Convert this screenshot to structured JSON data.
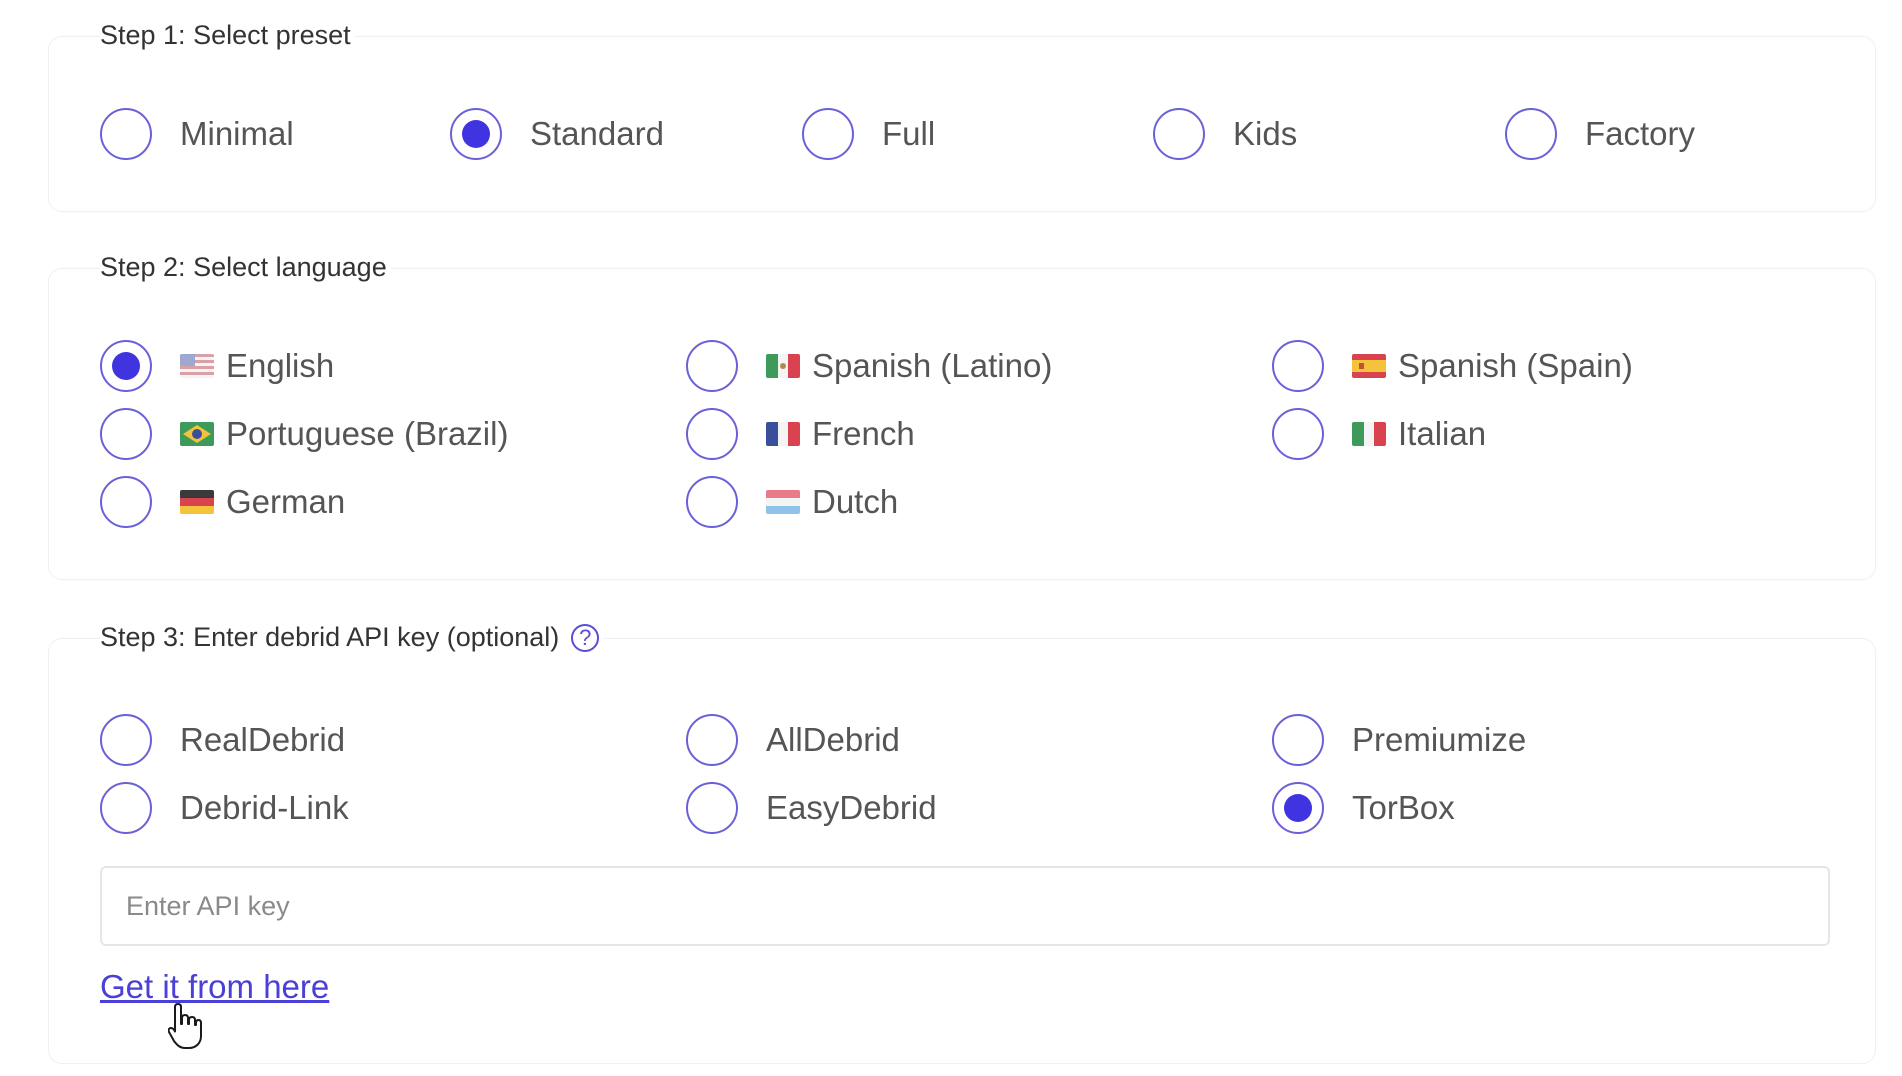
{
  "step1": {
    "title": "Step 1: Select preset",
    "options": [
      {
        "label": "Minimal",
        "checked": false
      },
      {
        "label": "Standard",
        "checked": true
      },
      {
        "label": "Full",
        "checked": false
      },
      {
        "label": "Kids",
        "checked": false
      },
      {
        "label": "Factory",
        "checked": false
      }
    ]
  },
  "step2": {
    "title": "Step 2: Select language",
    "options": [
      {
        "label": "English",
        "flag": "us-flag-icon",
        "checked": true
      },
      {
        "label": "Spanish (Latino)",
        "flag": "mexico-flag-icon",
        "checked": false
      },
      {
        "label": "Spanish (Spain)",
        "flag": "spain-flag-icon",
        "checked": false
      },
      {
        "label": "Portuguese (Brazil)",
        "flag": "brazil-flag-icon",
        "checked": false
      },
      {
        "label": "French",
        "flag": "france-flag-icon",
        "checked": false
      },
      {
        "label": "Italian",
        "flag": "italy-flag-icon",
        "checked": false
      },
      {
        "label": "German",
        "flag": "germany-flag-icon",
        "checked": false
      },
      {
        "label": "Dutch",
        "flag": "netherlands-flag-icon",
        "checked": false
      }
    ]
  },
  "step3": {
    "title": "Step 3: Enter debrid API key (optional)",
    "help_icon": "question-circle-icon",
    "options": [
      {
        "label": "RealDebrid",
        "checked": false
      },
      {
        "label": "AllDebrid",
        "checked": false
      },
      {
        "label": "Premiumize",
        "checked": false
      },
      {
        "label": "Debrid-Link",
        "checked": false
      },
      {
        "label": "EasyDebrid",
        "checked": false
      },
      {
        "label": "TorBox",
        "checked": true
      }
    ],
    "api_input_placeholder": "Enter API key",
    "api_input_value": "",
    "link_text": "Get it from here"
  },
  "colors": {
    "accent": "#3f34e0",
    "radio_border": "#6a60d8",
    "link": "#4a3fd6"
  },
  "help_glyph": "?"
}
